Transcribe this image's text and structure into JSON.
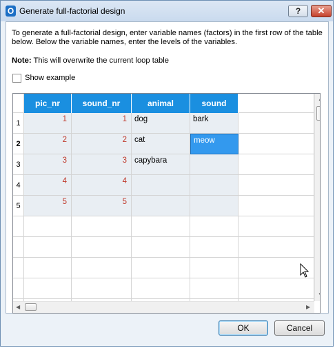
{
  "window": {
    "title": "Generate full-factorial design",
    "app_icon_letter": "O",
    "help_label": "?",
    "close_label": "✕"
  },
  "intro": "To generate a full-factorial design, enter variable names (factors) in the first row of the table below. Below the variable names, enter the levels of the variables.",
  "note": {
    "label": "Note:",
    "text": "This will overwrite the current loop table"
  },
  "show_example_label": "Show example",
  "table": {
    "columns": [
      "pic_nr",
      "sound_nr",
      "animal",
      "sound",
      ""
    ],
    "row_numbers": [
      "1",
      "2",
      "3",
      "4",
      "5"
    ],
    "rows": [
      [
        "1",
        "1",
        "dog",
        "bark"
      ],
      [
        "2",
        "2",
        "cat",
        "meow"
      ],
      [
        "3",
        "3",
        "capybara",
        ""
      ],
      [
        "4",
        "4",
        "",
        ""
      ],
      [
        "5",
        "5",
        "",
        ""
      ]
    ],
    "header_color": "#1a8fe0",
    "selected_color": "#3399ee"
  },
  "buttons": {
    "ok": "OK",
    "cancel": "Cancel"
  }
}
